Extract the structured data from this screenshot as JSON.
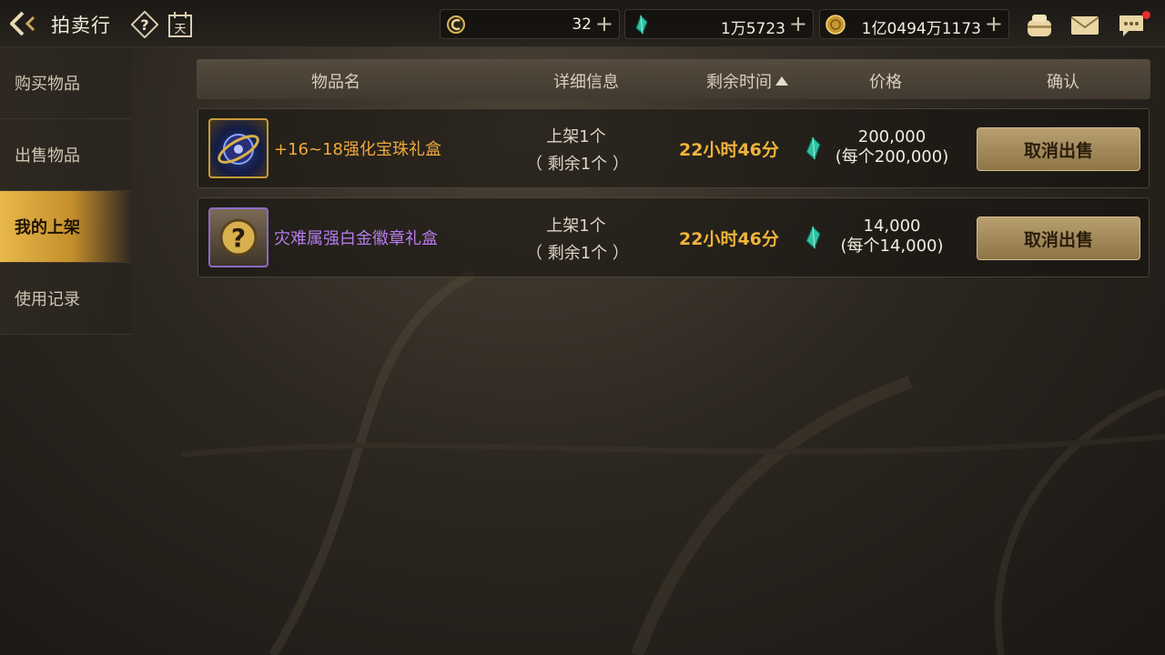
{
  "header": {
    "title": "拍卖行",
    "calendar_glyph": "天",
    "currencies": [
      {
        "icon": "c-coin-icon",
        "value": "32"
      },
      {
        "icon": "green-gem-icon",
        "value": "1万5723"
      },
      {
        "icon": "gold-coin-icon",
        "value": "1亿0494万1173"
      }
    ],
    "plus": "+"
  },
  "sidebar": {
    "items": [
      {
        "label": "购买物品",
        "active": false
      },
      {
        "label": "出售物品",
        "active": false
      },
      {
        "label": "我的上架",
        "active": true
      },
      {
        "label": "使用记录",
        "active": false
      }
    ]
  },
  "table": {
    "columns": {
      "name": "物品名",
      "detail": "详细信息",
      "time": "剩余时间",
      "price": "价格",
      "confirm": "确认"
    },
    "rows": [
      {
        "name": "+16~18强化宝珠礼盒",
        "name_color": "#f0a93a",
        "detail_line1": "上架1个",
        "detail_line2": "（ 剩余1个 ）",
        "time": "22小时46分",
        "price": "200,000",
        "price_each": "(每个200,000)",
        "button": "取消出售"
      },
      {
        "name": "灾难属强白金徽章礼盒",
        "name_color": "#b57bea",
        "detail_line1": "上架1个",
        "detail_line2": "（ 剩余1个 ）",
        "time": "22小时46分",
        "price": "14,000",
        "price_each": "(每个14,000)",
        "button": "取消出售"
      }
    ]
  },
  "colors": {
    "accent_gold": "#f0b43a",
    "active_tab": "#e8b84a",
    "notification": "#e52d2d"
  }
}
